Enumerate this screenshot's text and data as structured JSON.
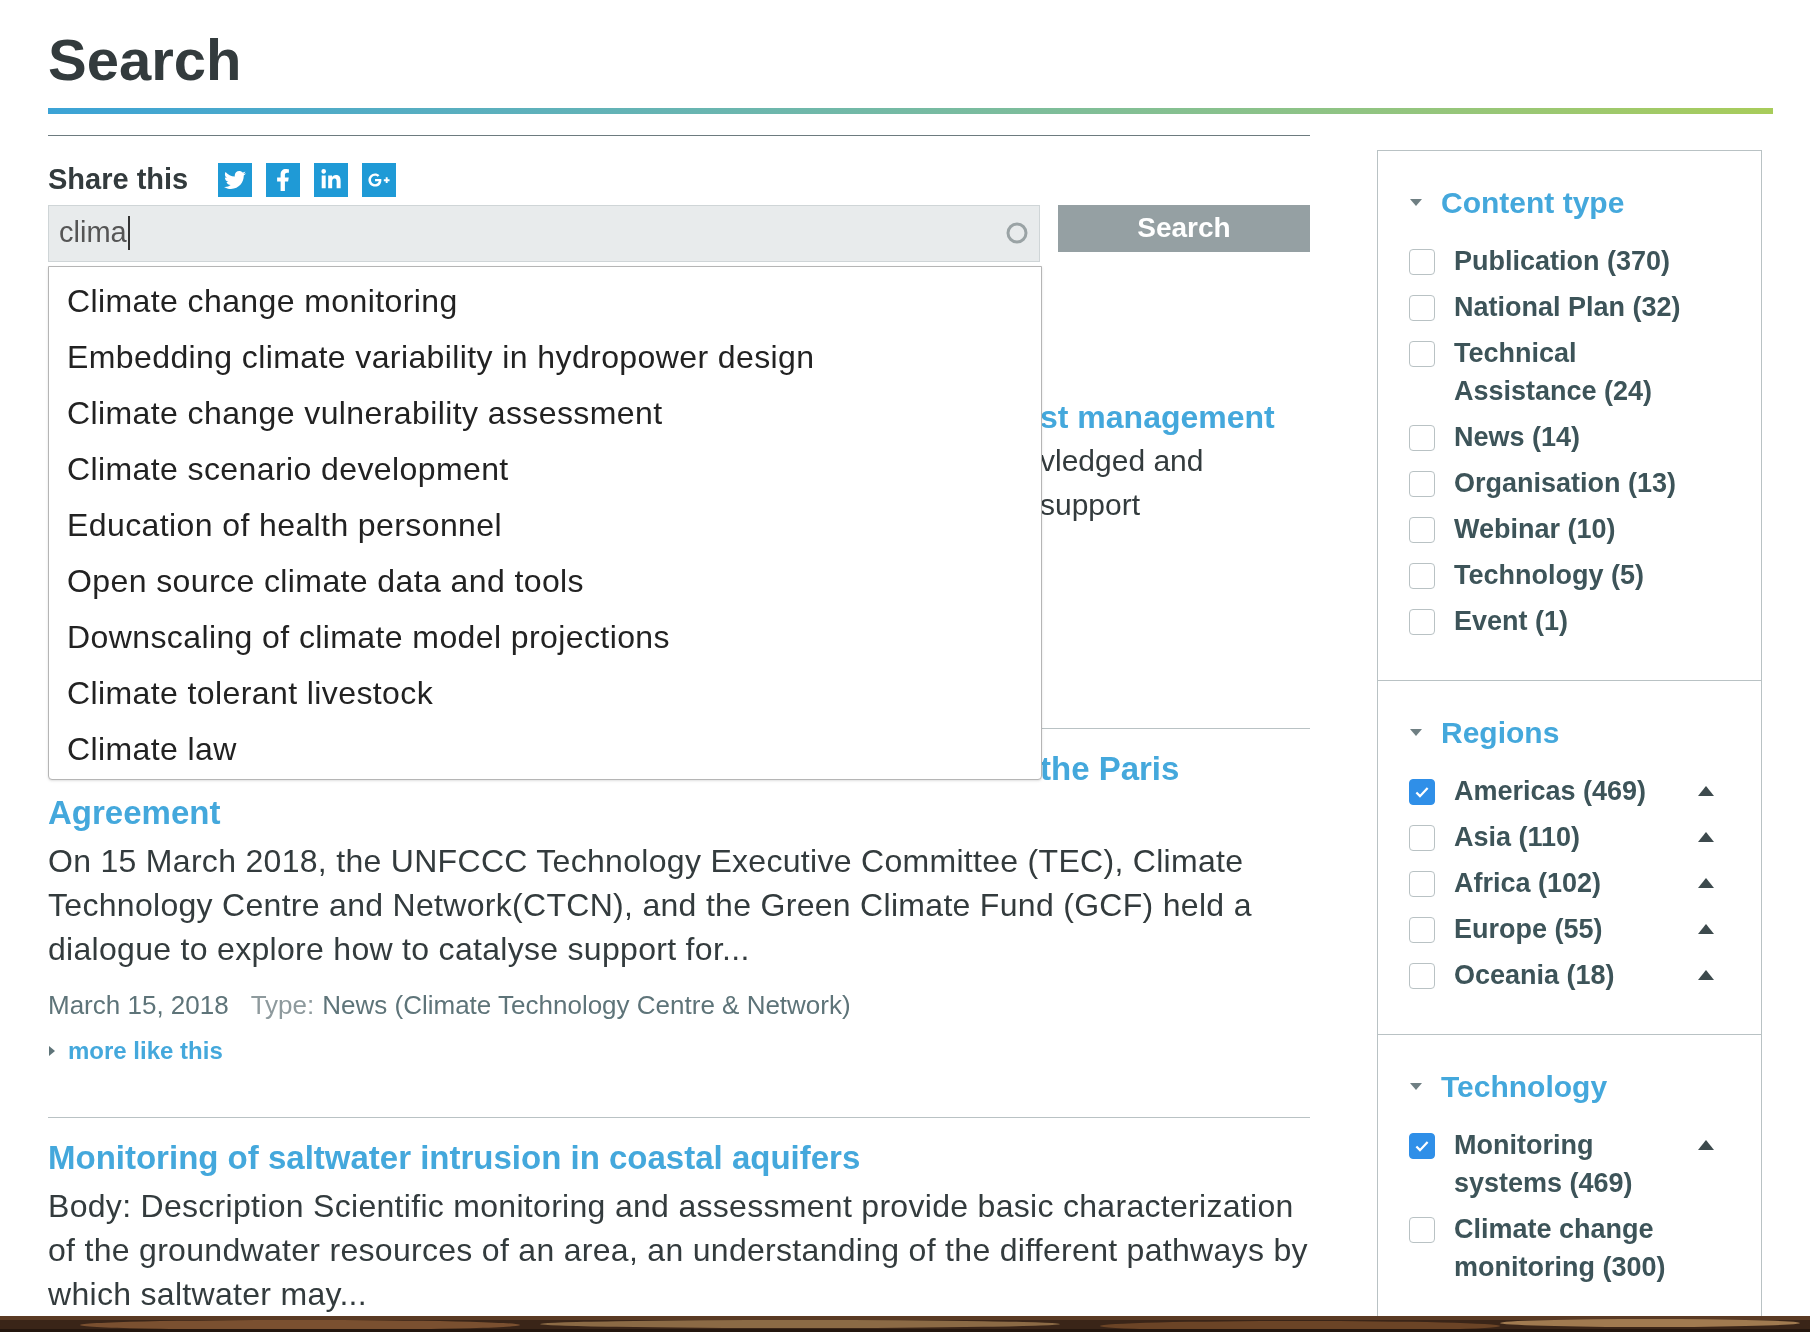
{
  "page": {
    "title": "Search"
  },
  "share": {
    "label": "Share this",
    "icons": [
      {
        "kind": "twitter"
      },
      {
        "kind": "facebook"
      },
      {
        "kind": "linkedin"
      },
      {
        "kind": "googleplus"
      }
    ]
  },
  "search": {
    "value": "clima",
    "button": "Search",
    "loading": true,
    "suggestions": [
      "Climate change monitoring",
      "Embedding climate variability in hydropower design",
      "Climate change vulnerability assessment",
      "Climate scenario development",
      "Education of health personnel",
      "Open source climate data and tools",
      "Downscaling of climate model projections",
      "Climate tolerant livestock",
      "Climate law"
    ]
  },
  "results": [
    {
      "kind": "covered",
      "title_lines": [
        "st management"
      ],
      "snippet_lines": [
        "vledged and",
        "support"
      ]
    },
    {
      "kind": "full",
      "first_line_covered": true,
      "title_lines": [
        "the Paris",
        "Agreement"
      ],
      "snippet": "On 15 March 2018, the UNFCCC Technology Executive Committee (TEC), Climate Technology Centre and Network(CTCN), and the Green Climate Fund (GCF) held a dialogue to explore how to catalyse support for...",
      "date": "March 15, 2018",
      "type_label": "Type:",
      "type_value": "News (Climate Technology Centre & Network)",
      "more": "more like this"
    },
    {
      "kind": "full",
      "first_line_covered": false,
      "title_lines": [
        "Monitoring of saltwater intrusion in coastal aquifers"
      ],
      "snippet": "Body: Description Scientific monitoring and assessment provide basic characterization of the groundwater resources of an area, an understanding of the different pathways by which saltwater may..."
    }
  ],
  "filters": [
    {
      "title": "Content type",
      "expanded": true,
      "items": [
        {
          "label": "Publication (370)",
          "checked": false,
          "expandable": false
        },
        {
          "label": "National Plan (32)",
          "checked": false,
          "expandable": false
        },
        {
          "label": "Technical Assistance (24)",
          "checked": false,
          "expandable": false
        },
        {
          "label": "News (14)",
          "checked": false,
          "expandable": false
        },
        {
          "label": "Organisation (13)",
          "checked": false,
          "expandable": false
        },
        {
          "label": "Webinar (10)",
          "checked": false,
          "expandable": false
        },
        {
          "label": "Technology (5)",
          "checked": false,
          "expandable": false
        },
        {
          "label": "Event (1)",
          "checked": false,
          "expandable": false
        }
      ]
    },
    {
      "title": "Regions",
      "expanded": true,
      "items": [
        {
          "label": "Americas (469)",
          "checked": true,
          "expandable": true
        },
        {
          "label": "Asia (110)",
          "checked": false,
          "expandable": true
        },
        {
          "label": "Africa (102)",
          "checked": false,
          "expandable": true
        },
        {
          "label": "Europe (55)",
          "checked": false,
          "expandable": true
        },
        {
          "label": "Oceania (18)",
          "checked": false,
          "expandable": true
        }
      ]
    },
    {
      "title": "Technology",
      "expanded": true,
      "items": [
        {
          "label": "Monitoring systems (469)",
          "checked": true,
          "expandable": true
        },
        {
          "label": "Climate change monitoring (300)",
          "checked": false,
          "expandable": false
        }
      ]
    }
  ]
}
